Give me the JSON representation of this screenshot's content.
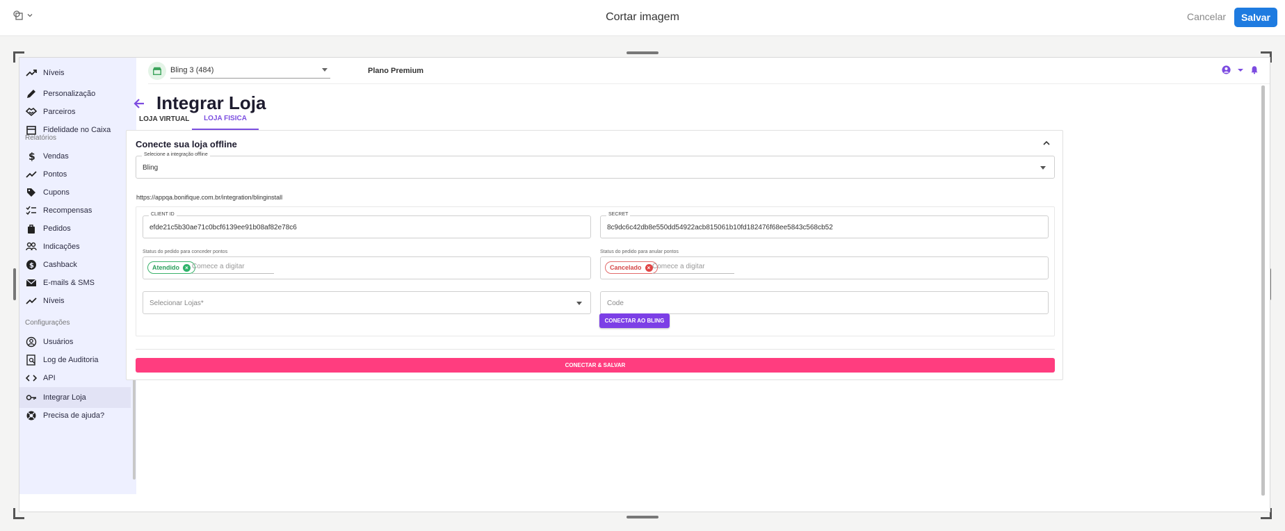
{
  "editor": {
    "title": "Cortar imagem",
    "cancel_label": "Cancelar",
    "save_label": "Salvar"
  },
  "sidebar": {
    "items_top": [
      {
        "label": "Níveis",
        "icon": "trending-up-icon"
      },
      {
        "label": "Personalização",
        "icon": "pencil-icon"
      },
      {
        "label": "Parceiros",
        "icon": "handshake-icon"
      },
      {
        "label": "Fidelidade no Caixa",
        "icon": "store-icon"
      }
    ],
    "section_reports": "Relatórios",
    "items_reports": [
      {
        "label": "Vendas",
        "icon": "dollar-icon"
      },
      {
        "label": "Pontos",
        "icon": "trending-up-icon"
      },
      {
        "label": "Cupons",
        "icon": "tag-icon"
      },
      {
        "label": "Recompensas",
        "icon": "checklist-icon"
      },
      {
        "label": "Pedidos",
        "icon": "bag-icon"
      },
      {
        "label": "Indicações",
        "icon": "people-icon"
      },
      {
        "label": "Cashback",
        "icon": "cash-icon"
      },
      {
        "label": "E-mails & SMS",
        "icon": "mail-icon"
      },
      {
        "label": "Níveis",
        "icon": "trending-up-icon"
      }
    ],
    "section_config": "Configurações",
    "items_config": [
      {
        "label": "Usuários",
        "icon": "user-circle-icon"
      },
      {
        "label": "Log de Auditoria",
        "icon": "audit-log-icon"
      },
      {
        "label": "API",
        "icon": "code-icon"
      },
      {
        "label": "Integrar Loja",
        "icon": "key-icon"
      },
      {
        "label": "Precisa de ajuda?",
        "icon": "help-lifebuoy-icon"
      }
    ]
  },
  "header": {
    "store_select": "Bling 3 (484)",
    "plan": "Plano Premium"
  },
  "page": {
    "title": "Integrar Loja",
    "tabs": [
      {
        "label": "LOJA VIRTUAL"
      },
      {
        "label": "LOJA FISICA"
      }
    ],
    "card_title": "Conecte sua loja offline",
    "integration_label": "Selecione a integração offline",
    "integration_value": "Bling",
    "install_url": "https://appqa.bonifique.com.br/integration/blinginstall",
    "client_id_label": "CLIENT ID",
    "client_id_value": "efde21c5b30ae71c0bcf6139ee91b08af82e78c6",
    "secret_label": "SECRET",
    "secret_value": "8c9dc6c42db8e550dd54922acb815061b10fd182476f68ee5843c568cb52",
    "grant_status_label": "Status do pedido para conceder pontos",
    "grant_chip": "Atendido",
    "cancel_status_label": "Status do pedido para anular pontos",
    "cancel_chip": "Cancelado",
    "typing_placeholder": "Comece a digitar",
    "stores_placeholder": "Selecionar Lojas*",
    "code_placeholder": "Code",
    "connect_bling_label": "CONECTAR AO BLING",
    "connect_save_label": "CONECTAR & SALVAR"
  },
  "colors": {
    "accent_purple": "#7c3fe6",
    "pink_button": "#ff3d7f",
    "save_blue": "#1e7be0"
  }
}
